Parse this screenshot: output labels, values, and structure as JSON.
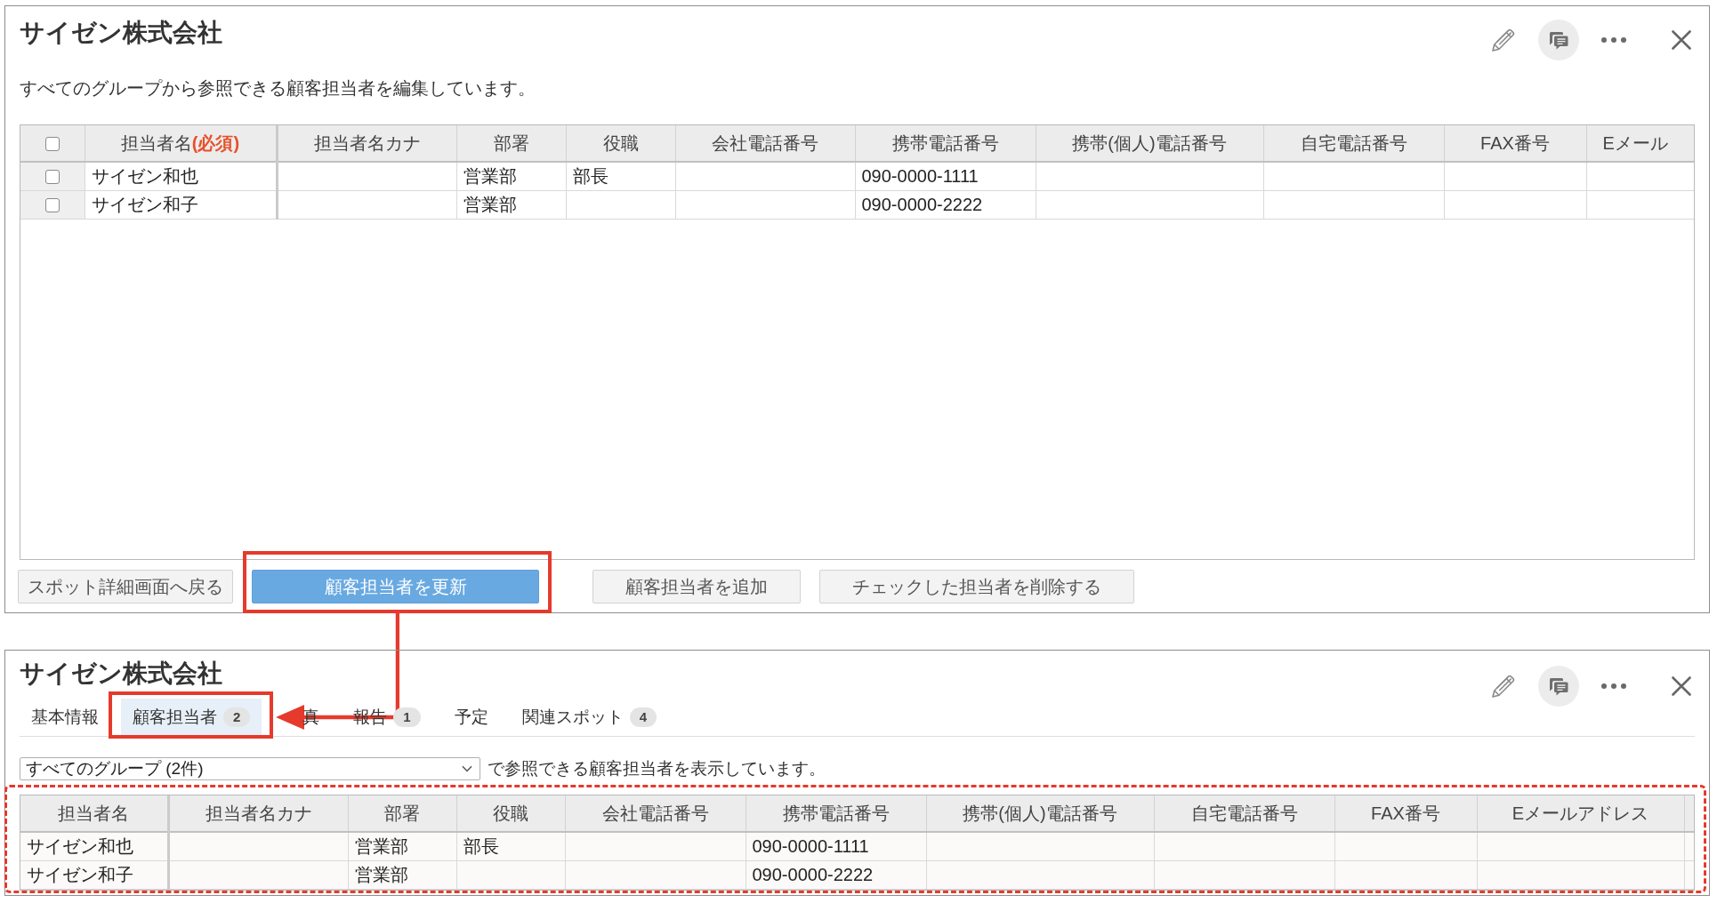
{
  "edit_panel": {
    "title": "サイゼン株式会社",
    "description": "すべてのグループから参照できる顧客担当者を編集しています。",
    "table": {
      "select_all_checked": false,
      "columns": [
        "担当者名**(必須)**",
        "担当者名カナ",
        "部署",
        "役職",
        "会社電話番号",
        "携帯電話番号",
        "携帯(個人)電話番号",
        "自宅電話番号",
        "FAX番号",
        "Eメール"
      ],
      "rows": [
        {
          "checked": false,
          "cells": [
            "サイゼン和也",
            null,
            "営業部",
            "部長",
            null,
            "090-0000-1111",
            null,
            null,
            null,
            null
          ]
        },
        {
          "checked": false,
          "cells": [
            "サイゼン和子",
            null,
            "営業部",
            null,
            null,
            "090-0000-2222",
            null,
            null,
            null,
            null
          ]
        }
      ]
    },
    "buttons": [
      {
        "label": "スポット詳細画面へ戻る",
        "kind": "secondary",
        "highlighted": false
      },
      {
        "label": "顧客担当者を更新",
        "kind": "primary",
        "highlighted": true
      },
      {
        "label": "顧客担当者を追加",
        "kind": "default",
        "highlighted": false
      },
      {
        "label": "チェックした担当者を削除する",
        "kind": "default",
        "highlighted": false
      }
    ]
  },
  "callout_arrow": true,
  "detail_panel": {
    "title": "サイゼン株式会社",
    "tabs": [
      {
        "label": "基本情報",
        "selected": false,
        "highlighted": false
      },
      {
        "label": "顧客担当者",
        "count": "2",
        "selected": true,
        "highlighted": true
      },
      {
        "label": "真",
        "selected": false,
        "highlighted": false
      },
      {
        "label": "報告",
        "count": "1",
        "selected": false,
        "highlighted": false
      },
      {
        "label": "予定",
        "selected": false,
        "highlighted": false
      },
      {
        "label": "関連スポット",
        "count": "4",
        "selected": false,
        "highlighted": false
      }
    ],
    "group_filter": {
      "value": "すべてのグループ (2件)",
      "caption": "で参照できる顧客担当者を表示しています。"
    },
    "table": {
      "highlighted": true,
      "columns": [
        "担当者名",
        "担当者名カナ",
        "部署",
        "役職",
        "会社電話番号",
        "携帯電話番号",
        "携帯(個人)電話番号",
        "自宅電話番号",
        "FAX番号",
        "Eメールアドレス"
      ],
      "rows": [
        {
          "cells": [
            "サイゼン和也",
            null,
            "営業部",
            "部長",
            null,
            "090-0000-1111",
            null,
            null,
            null,
            null
          ]
        },
        {
          "cells": [
            "サイゼン和子",
            null,
            "営業部",
            null,
            null,
            "090-0000-2222",
            null,
            null,
            null,
            null
          ]
        }
      ]
    }
  }
}
